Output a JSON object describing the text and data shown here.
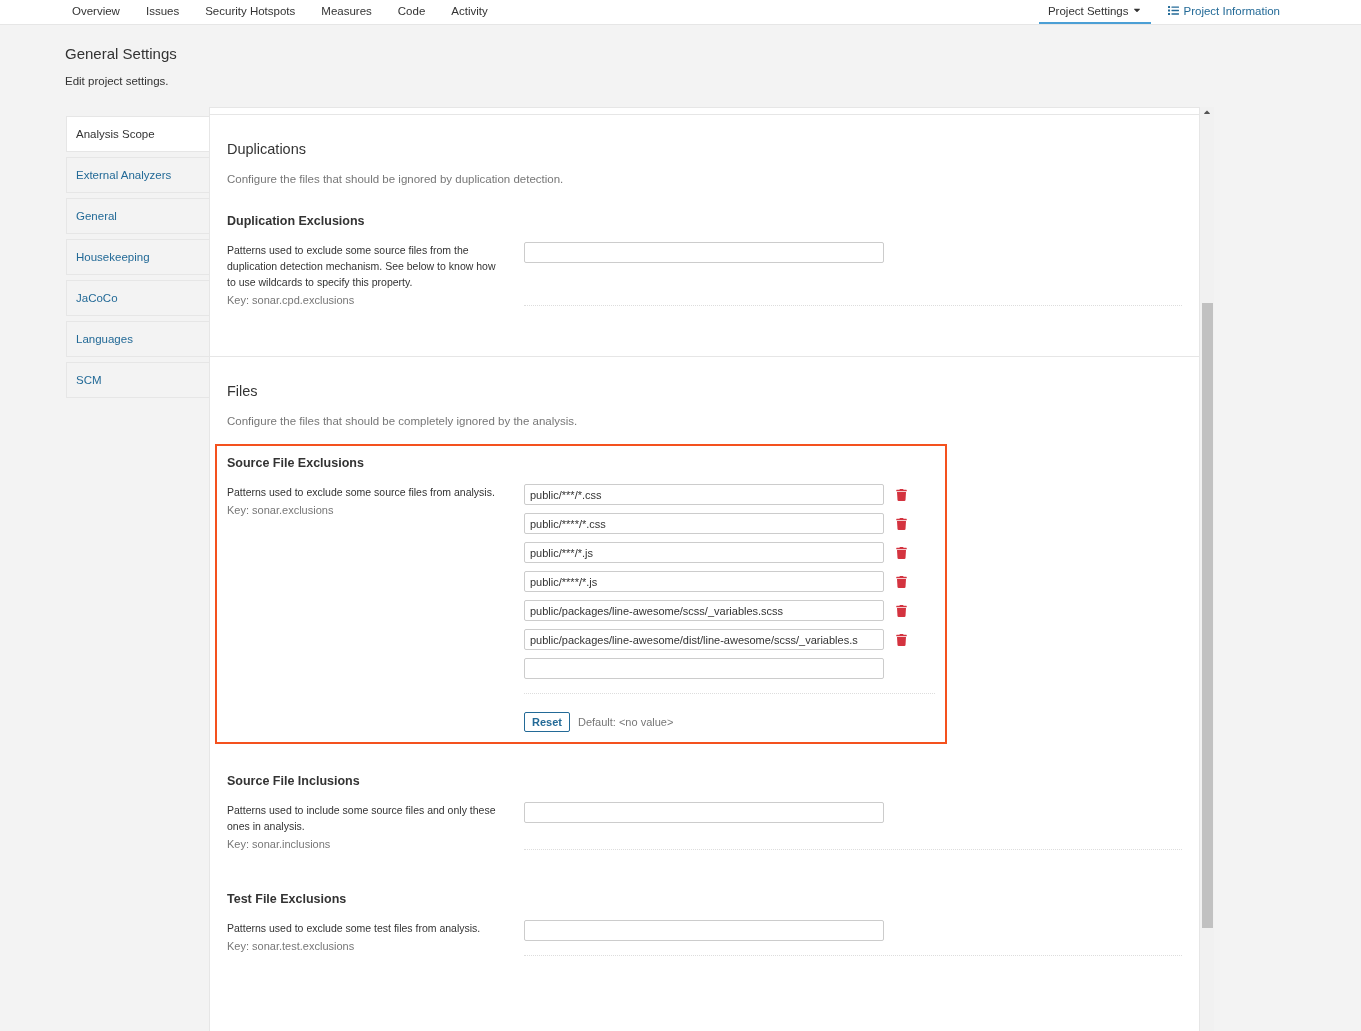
{
  "nav": {
    "items": [
      {
        "label": "Overview",
        "selected": false
      },
      {
        "label": "Issues",
        "selected": false
      },
      {
        "label": "Security Hotspots",
        "selected": false
      },
      {
        "label": "Measures",
        "selected": false
      },
      {
        "label": "Code",
        "selected": false
      },
      {
        "label": "Activity",
        "selected": false
      }
    ],
    "right": [
      {
        "label": "Project Settings",
        "selected": true,
        "kind": "dropdown"
      },
      {
        "label": "Project Information",
        "selected": false,
        "kind": "info"
      }
    ]
  },
  "header": {
    "title": "General Settings",
    "subtitle": "Edit project settings."
  },
  "sidebar": {
    "items": [
      {
        "label": "Analysis Scope",
        "selected": true
      },
      {
        "label": "External Analyzers",
        "selected": false
      },
      {
        "label": "General",
        "selected": false
      },
      {
        "label": "Housekeeping",
        "selected": false
      },
      {
        "label": "JaCoCo",
        "selected": false
      },
      {
        "label": "Languages",
        "selected": false
      },
      {
        "label": "SCM",
        "selected": false
      }
    ]
  },
  "sections": [
    {
      "title": "Duplications",
      "description": "Configure the files that should be ignored by duplication detection.",
      "properties": [
        {
          "name": "Duplication Exclusions",
          "description": "Patterns used to exclude some source files from the duplication detection mechanism. See below to know how to use wildcards to specify this property.",
          "key": "Key: sonar.cpd.exclusions",
          "highlighted": false
        }
      ]
    },
    {
      "title": "Files",
      "description": "Configure the files that should be completely ignored by the analysis.",
      "properties": [
        {
          "name": "Source File Exclusions",
          "description": "Patterns used to exclude some source files from analysis.",
          "key": "Key: sonar.exclusions",
          "highlighted": true,
          "values": [
            "public/***/*.css",
            "public/****/*.css",
            "public/***/*.js",
            "public/****/*.js",
            "public/packages/line-awesome/scss/_variables.scss",
            "public/packages/line-awesome/dist/line-awesome/scss/_variables.s"
          ],
          "reset": "Reset",
          "default": "Default: <no value>"
        },
        {
          "name": "Source File Inclusions",
          "description": "Patterns used to include some source files and only these ones in analysis.",
          "key": "Key: sonar.inclusions",
          "highlighted": false
        },
        {
          "name": "Test File Exclusions",
          "description": "Patterns used to exclude some test files from analysis.",
          "key": "Key: sonar.test.exclusions",
          "highlighted": false
        }
      ]
    }
  ]
}
